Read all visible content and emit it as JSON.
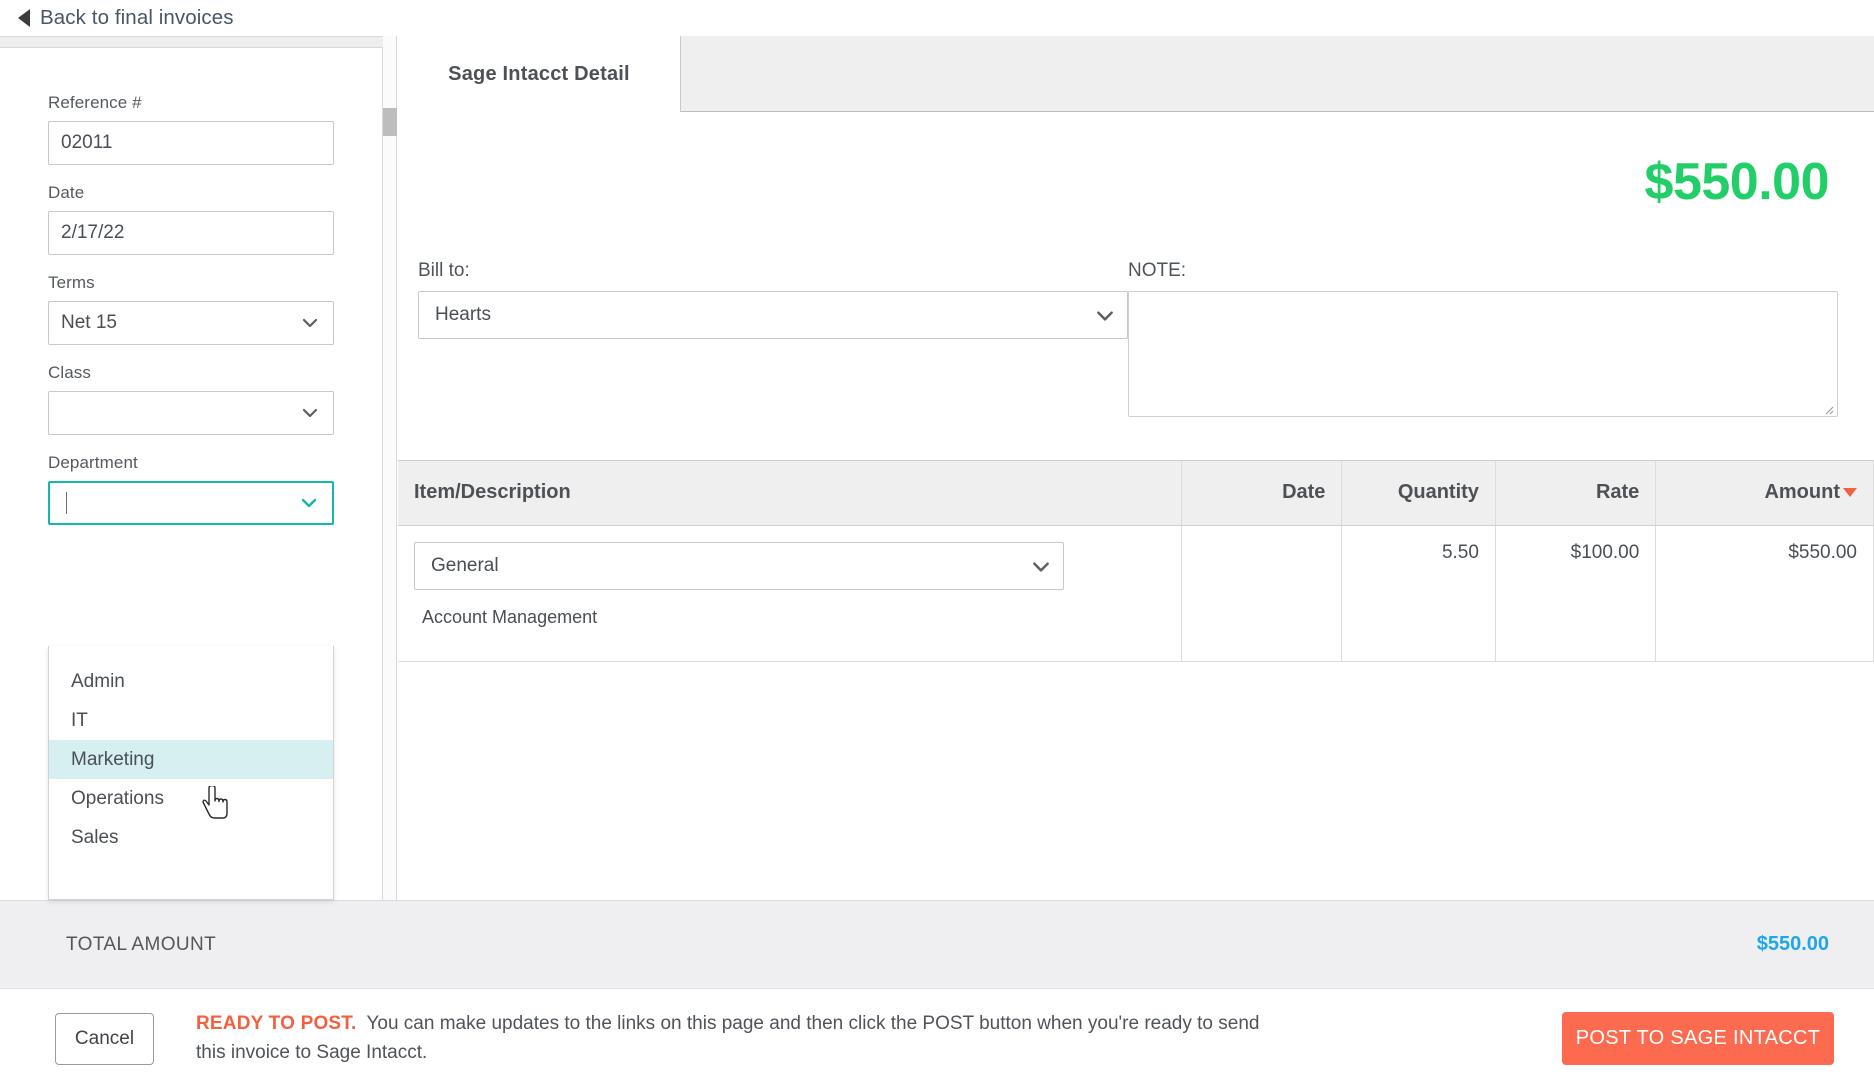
{
  "nav": {
    "back_label": "Back to final invoices",
    "back_icon": "triangle-left-icon"
  },
  "sidebar": {
    "fields": [
      {
        "label": "Reference #",
        "value": "02011",
        "type": "text"
      },
      {
        "label": "Date",
        "value": "2/17/22",
        "type": "text"
      },
      {
        "label": "Terms",
        "value": "Net 15",
        "type": "select"
      },
      {
        "label": "Class",
        "value": "",
        "type": "select"
      },
      {
        "label": "Department",
        "value": "",
        "type": "select",
        "focused": true
      }
    ],
    "department_dropdown": {
      "open": true,
      "options": [
        "Admin",
        "IT",
        "Marketing",
        "Operations",
        "Sales"
      ],
      "highlighted": "Marketing"
    }
  },
  "main": {
    "tab_label": "Sage Intacct Detail",
    "big_amount": "$550.00",
    "bill_to": {
      "label": "Bill to:",
      "value": "Hearts"
    },
    "note": {
      "label": "NOTE:",
      "value": "",
      "placeholder": ""
    },
    "table": {
      "headers": {
        "item": "Item/Description",
        "date": "Date",
        "quantity": "Quantity",
        "rate": "Rate",
        "amount": "Amount"
      },
      "sorted_by": "amount",
      "sort_direction": "desc",
      "rows": [
        {
          "item": "General",
          "description": "Account Management",
          "date": "",
          "quantity": "5.50",
          "rate": "$100.00",
          "amount": "$550.00"
        }
      ]
    }
  },
  "footer": {
    "total_label": "TOTAL AMOUNT",
    "total_value": "$550.00"
  },
  "actions": {
    "cancel_label": "Cancel",
    "status_prefix": "READY TO POST.",
    "status_text": "You can make updates to the links on this page and then click the POST button when you're ready to send this invoice to Sage Intacct.",
    "post_label": "POST TO SAGE INTACCT"
  },
  "colors": {
    "accent_green": "#22ce68",
    "accent_orange": "#fc6a4f",
    "accent_blue": "#1ea7ec",
    "focus_teal": "#14b7b0",
    "highlight_row": "#d6eff1"
  }
}
